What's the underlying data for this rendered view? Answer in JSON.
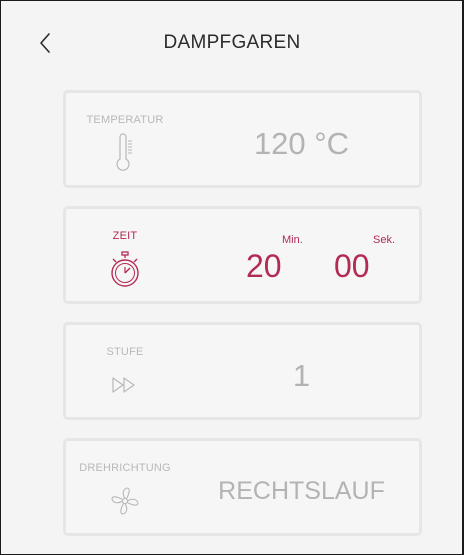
{
  "header": {
    "title": "DAMPFGAREN",
    "back_icon": "chevron-left-icon"
  },
  "cards": {
    "temperature": {
      "label": "TEMPERATUR",
      "value": "120 °C",
      "icon": "thermometer-icon",
      "active": false
    },
    "time": {
      "label": "ZEIT",
      "minutes": "20",
      "minutes_unit": "Min.",
      "seconds": "00",
      "seconds_unit": "Sek.",
      "icon": "stopwatch-icon",
      "active": true
    },
    "level": {
      "label": "STUFE",
      "value": "1",
      "icon": "fast-forward-icon",
      "active": false
    },
    "direction": {
      "label": "DREHRICHTUNG",
      "value": "RECHTSLAUF",
      "icon": "fan-rotation-icon",
      "active": false
    }
  },
  "colors": {
    "accent": "#b32b53",
    "inactive_text": "#b3b3b3",
    "card_border": "#e6e6e6",
    "background": "#f4f4f4"
  }
}
